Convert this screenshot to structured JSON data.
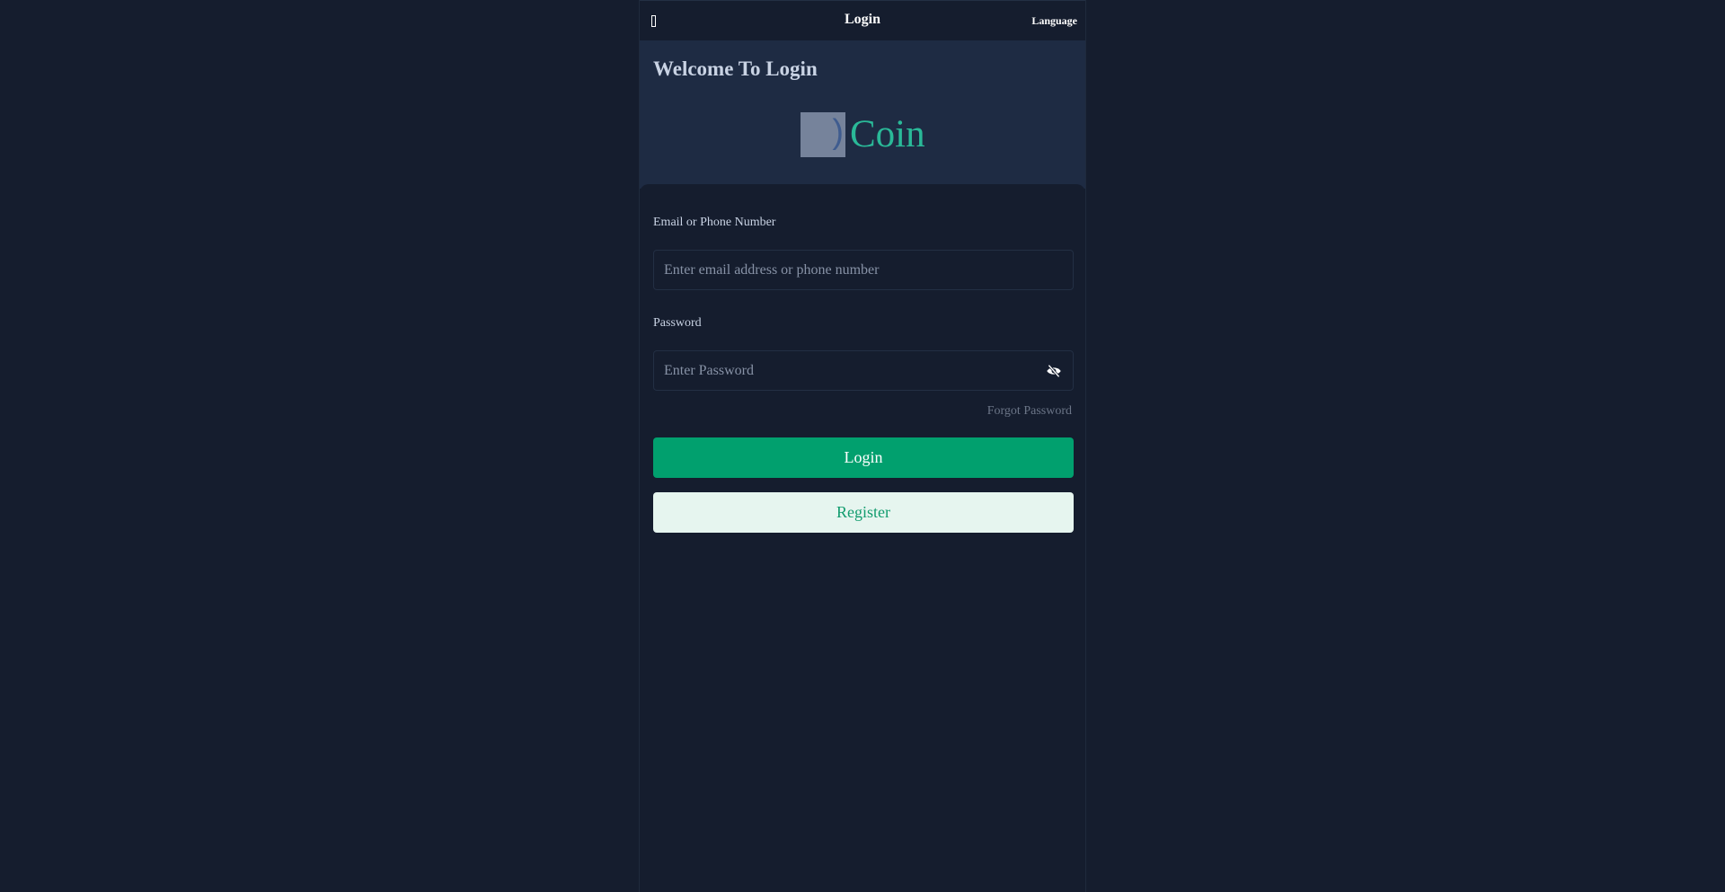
{
  "header": {
    "title": "Login",
    "language_label": "Language",
    "back_icon": "back-icon"
  },
  "hero": {
    "welcome": "Welcome To Login",
    "logo_text": "Coin"
  },
  "form": {
    "email_label": "Email or Phone Number",
    "email_placeholder": "Enter email address or phone number",
    "email_value": "",
    "password_label": "Password",
    "password_placeholder": "Enter Password",
    "password_value": "",
    "eye_icon": "eye-off-icon",
    "forgot_label": "Forgot Password",
    "login_label": "Login",
    "register_label": "Register"
  },
  "colors": {
    "background": "#151d2e",
    "hero": "#1e2b43",
    "accent": "#01a06e",
    "logo": "#2ab998",
    "register_bg": "#e6f5ef"
  }
}
